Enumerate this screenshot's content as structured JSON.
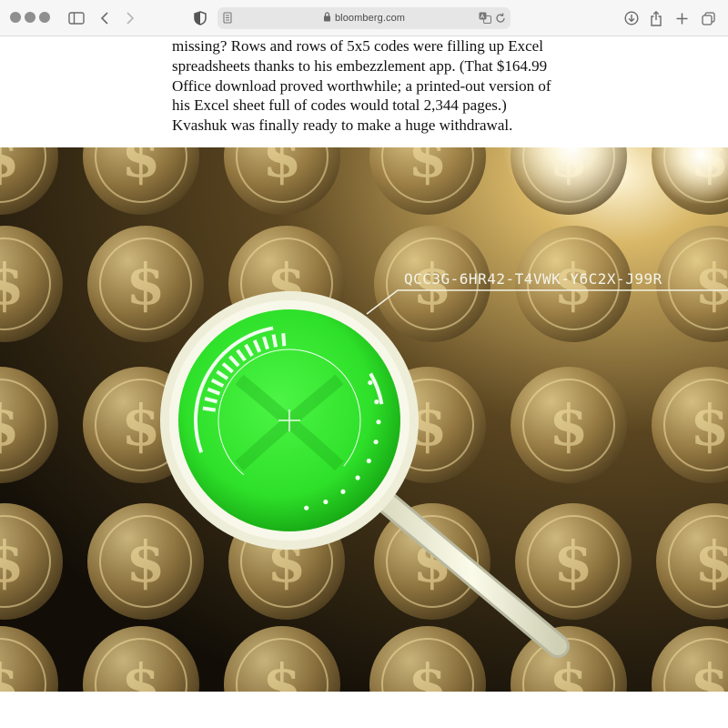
{
  "browser": {
    "url": "bloomberg.com",
    "icons": {
      "window_controls": "traffic-lights",
      "sidebar": "sidebar-icon",
      "back": "chevron-left-icon",
      "forward": "chevron-right-icon",
      "privacy": "shield-icon",
      "reader": "page-icon",
      "lock": "lock-icon",
      "translate": "translate-icon",
      "reload": "reload-icon",
      "downloads": "download-icon",
      "share": "share-icon",
      "new_tab": "plus-icon",
      "tab_overview": "tabs-icon"
    }
  },
  "article": {
    "paragraph_lines": [
      "missing? Rows and rows of 5x5 codes were filling up Excel",
      "spreadsheets thanks to his embezzlement app. (That $164.99",
      "Office download proved worthwhile; a printed-out version of",
      "his Excel sheet full of codes would total 2,344 pages.)",
      "Kvashuk was finally ready to make a huge withdrawal."
    ]
  },
  "illustration": {
    "code_text": "QCC3G-6HR42-T4VWK-Y6C2X-J99R",
    "coin_symbol": "$",
    "colors": {
      "coin": "#b89a5a",
      "background": "#1a150c",
      "lens_green": "#2ee829",
      "ring": "#f4f3dc"
    }
  }
}
